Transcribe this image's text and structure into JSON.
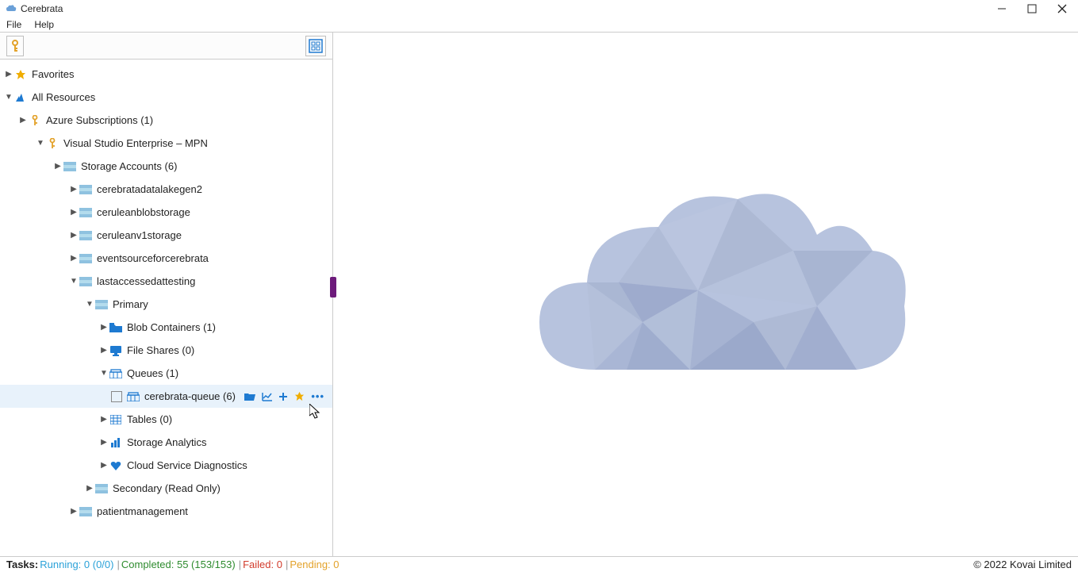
{
  "window": {
    "title": "Cerebrata"
  },
  "menu": {
    "file": "File",
    "help": "Help"
  },
  "tree": {
    "favorites": "Favorites",
    "all_resources": "All Resources",
    "azure_subs": "Azure Subscriptions (1)",
    "vs_enterprise": "Visual Studio Enterprise – MPN",
    "storage_accounts": "Storage Accounts (6)",
    "sa_datalake": "cerebratadatalakegen2",
    "sa_cerulean_blob": "ceruleanblobstorage",
    "sa_cerulean_v1": "ceruleanv1storage",
    "sa_eventsource": "eventsourceforcerebrata",
    "sa_lastaccessed": "lastaccessedattesting",
    "primary": "Primary",
    "blob_containers": "Blob Containers (1)",
    "file_shares": "File Shares (0)",
    "queues": "Queues (1)",
    "cerebrata_queue": "cerebrata-queue (6)",
    "tables": "Tables (0)",
    "storage_analytics": "Storage Analytics",
    "cloud_diag": "Cloud Service Diagnostics",
    "secondary": "Secondary (Read Only)",
    "sa_patient": "patientmanagement"
  },
  "status": {
    "tasks_label": "Tasks",
    "running": "Running: 0 (0/0)",
    "completed": "Completed: 55 (153/153)",
    "failed": "Failed: 0",
    "pending": "Pending: 0",
    "copyright": "© 2022 Kovai Limited"
  }
}
